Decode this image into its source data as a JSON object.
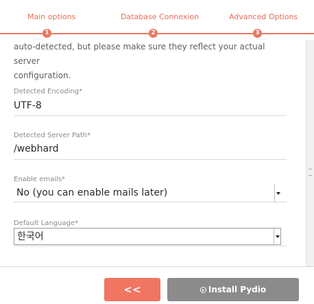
{
  "stepper": {
    "steps": [
      {
        "label": "Main options",
        "number": "1"
      },
      {
        "label": "Database Connexion",
        "number": "2"
      },
      {
        "label": "Advanced Options",
        "number": "3"
      }
    ],
    "accent": "#e8775f"
  },
  "form": {
    "intro_line1": "auto-detected, but please make sure they reflect your actual server",
    "intro_line2": "configuration.",
    "encoding": {
      "label": "Detected Encoding*",
      "value": "UTF-8"
    },
    "server_path": {
      "label": "Detected Server Path*",
      "value": "/webhard"
    },
    "emails": {
      "label": "Enable emails*",
      "selected": "No (you can enable mails later)"
    },
    "language": {
      "label": "Default Language*",
      "selected": "한국어"
    }
  },
  "footer": {
    "back_label": "<<",
    "install_label": "Install Pydio",
    "back_color": "#f07662",
    "install_color": "#8b8b8b"
  }
}
